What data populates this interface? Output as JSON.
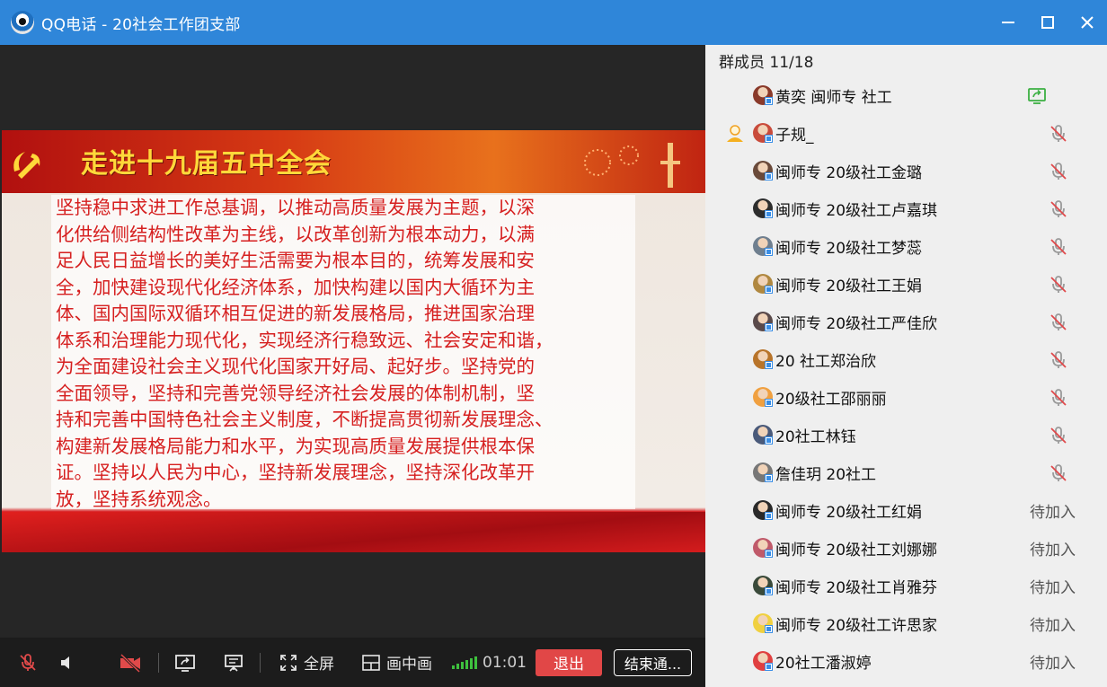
{
  "window": {
    "title": "QQ电话 - 20社会工作团支部"
  },
  "slide": {
    "title": "走进十九届五中全会",
    "lines": [
      "坚持稳中求进工作总基调，以推动高质量发展为主题，以深",
      "化供给侧结构性改革为主线，以改革创新为根本动力，以满",
      "足人民日益增长的美好生活需要为根本目的，统筹发展和安",
      "全，加快建设现代化经济体系，加快构建以国内大循环为主",
      "体、国内国际双循环相互促进的新发展格局，推进国家治理",
      "体系和治理能力现代化，实现经济行稳致远、社会安定和谐，",
      "为全面建设社会主义现代化国家开好局、起好步。坚持党的",
      "全面领导，坚持和完善党领导经济社会发展的体制机制，坚",
      "持和完善中国特色社会主义制度，不断提高贯彻新发展理念、",
      "构建新发展格局能力和水平，为实现高质量发展提供根本保",
      "证。坚持以人民为中心，坚持新发展理念，坚持深化改革开",
      "放，坚持系统观念。"
    ]
  },
  "toolbar": {
    "fullscreen_label": "全屏",
    "pip_label": "画中画",
    "timer": "01:01",
    "exit_label": "退出",
    "end_label": "结束通..."
  },
  "panel": {
    "title": "群成员 11/18",
    "members": [
      {
        "name": "黄奕 闽师专 社工",
        "status": "",
        "icon": "screen-share-icon",
        "avatar_color": "#8a3a2a"
      },
      {
        "name": "子规_",
        "status": "",
        "icon": "mic-muted-icon",
        "avatar_color": "#c94b3b",
        "host": true
      },
      {
        "name": "闽师专 20级社工金璐",
        "status": "",
        "icon": "mic-muted-icon",
        "avatar_color": "#6a4a3a"
      },
      {
        "name": "闽师专 20级社工卢嘉琪",
        "status": "",
        "icon": "mic-muted-icon",
        "avatar_color": "#2d2d2d"
      },
      {
        "name": "闽师专 20级社工梦蕊",
        "status": "",
        "icon": "mic-muted-icon",
        "avatar_color": "#6f7f8f"
      },
      {
        "name": "闽师专 20级社工王娟",
        "status": "",
        "icon": "mic-muted-icon",
        "avatar_color": "#b08840"
      },
      {
        "name": "闽师专 20级社工严佳欣",
        "status": "",
        "icon": "mic-muted-icon",
        "avatar_color": "#5a4a4a"
      },
      {
        "name": "20 社工郑治欣",
        "status": "",
        "icon": "mic-muted-icon",
        "avatar_color": "#b8742a"
      },
      {
        "name": "20级社工邵丽丽",
        "status": "",
        "icon": "mic-muted-icon",
        "avatar_color": "#f0a040"
      },
      {
        "name": "20社工林钰",
        "status": "",
        "icon": "mic-muted-icon",
        "avatar_color": "#4a5a7a"
      },
      {
        "name": "詹佳玥 20社工",
        "status": "",
        "icon": "mic-muted-icon",
        "avatar_color": "#777777"
      },
      {
        "name": "闽师专 20级社工红娟",
        "status": "待加入",
        "icon": "",
        "avatar_color": "#2a2a2a"
      },
      {
        "name": "闽师专 20级社工刘娜娜",
        "status": "待加入",
        "icon": "",
        "avatar_color": "#c05a6a"
      },
      {
        "name": "闽师专 20级社工肖雅芬",
        "status": "待加入",
        "icon": "",
        "avatar_color": "#3a4a3a"
      },
      {
        "name": "闽师专 20级社工许思家",
        "status": "待加入",
        "icon": "",
        "avatar_color": "#f0d040"
      },
      {
        "name": "20社工潘淑婷",
        "status": "待加入",
        "icon": "",
        "avatar_color": "#e04040"
      }
    ]
  }
}
